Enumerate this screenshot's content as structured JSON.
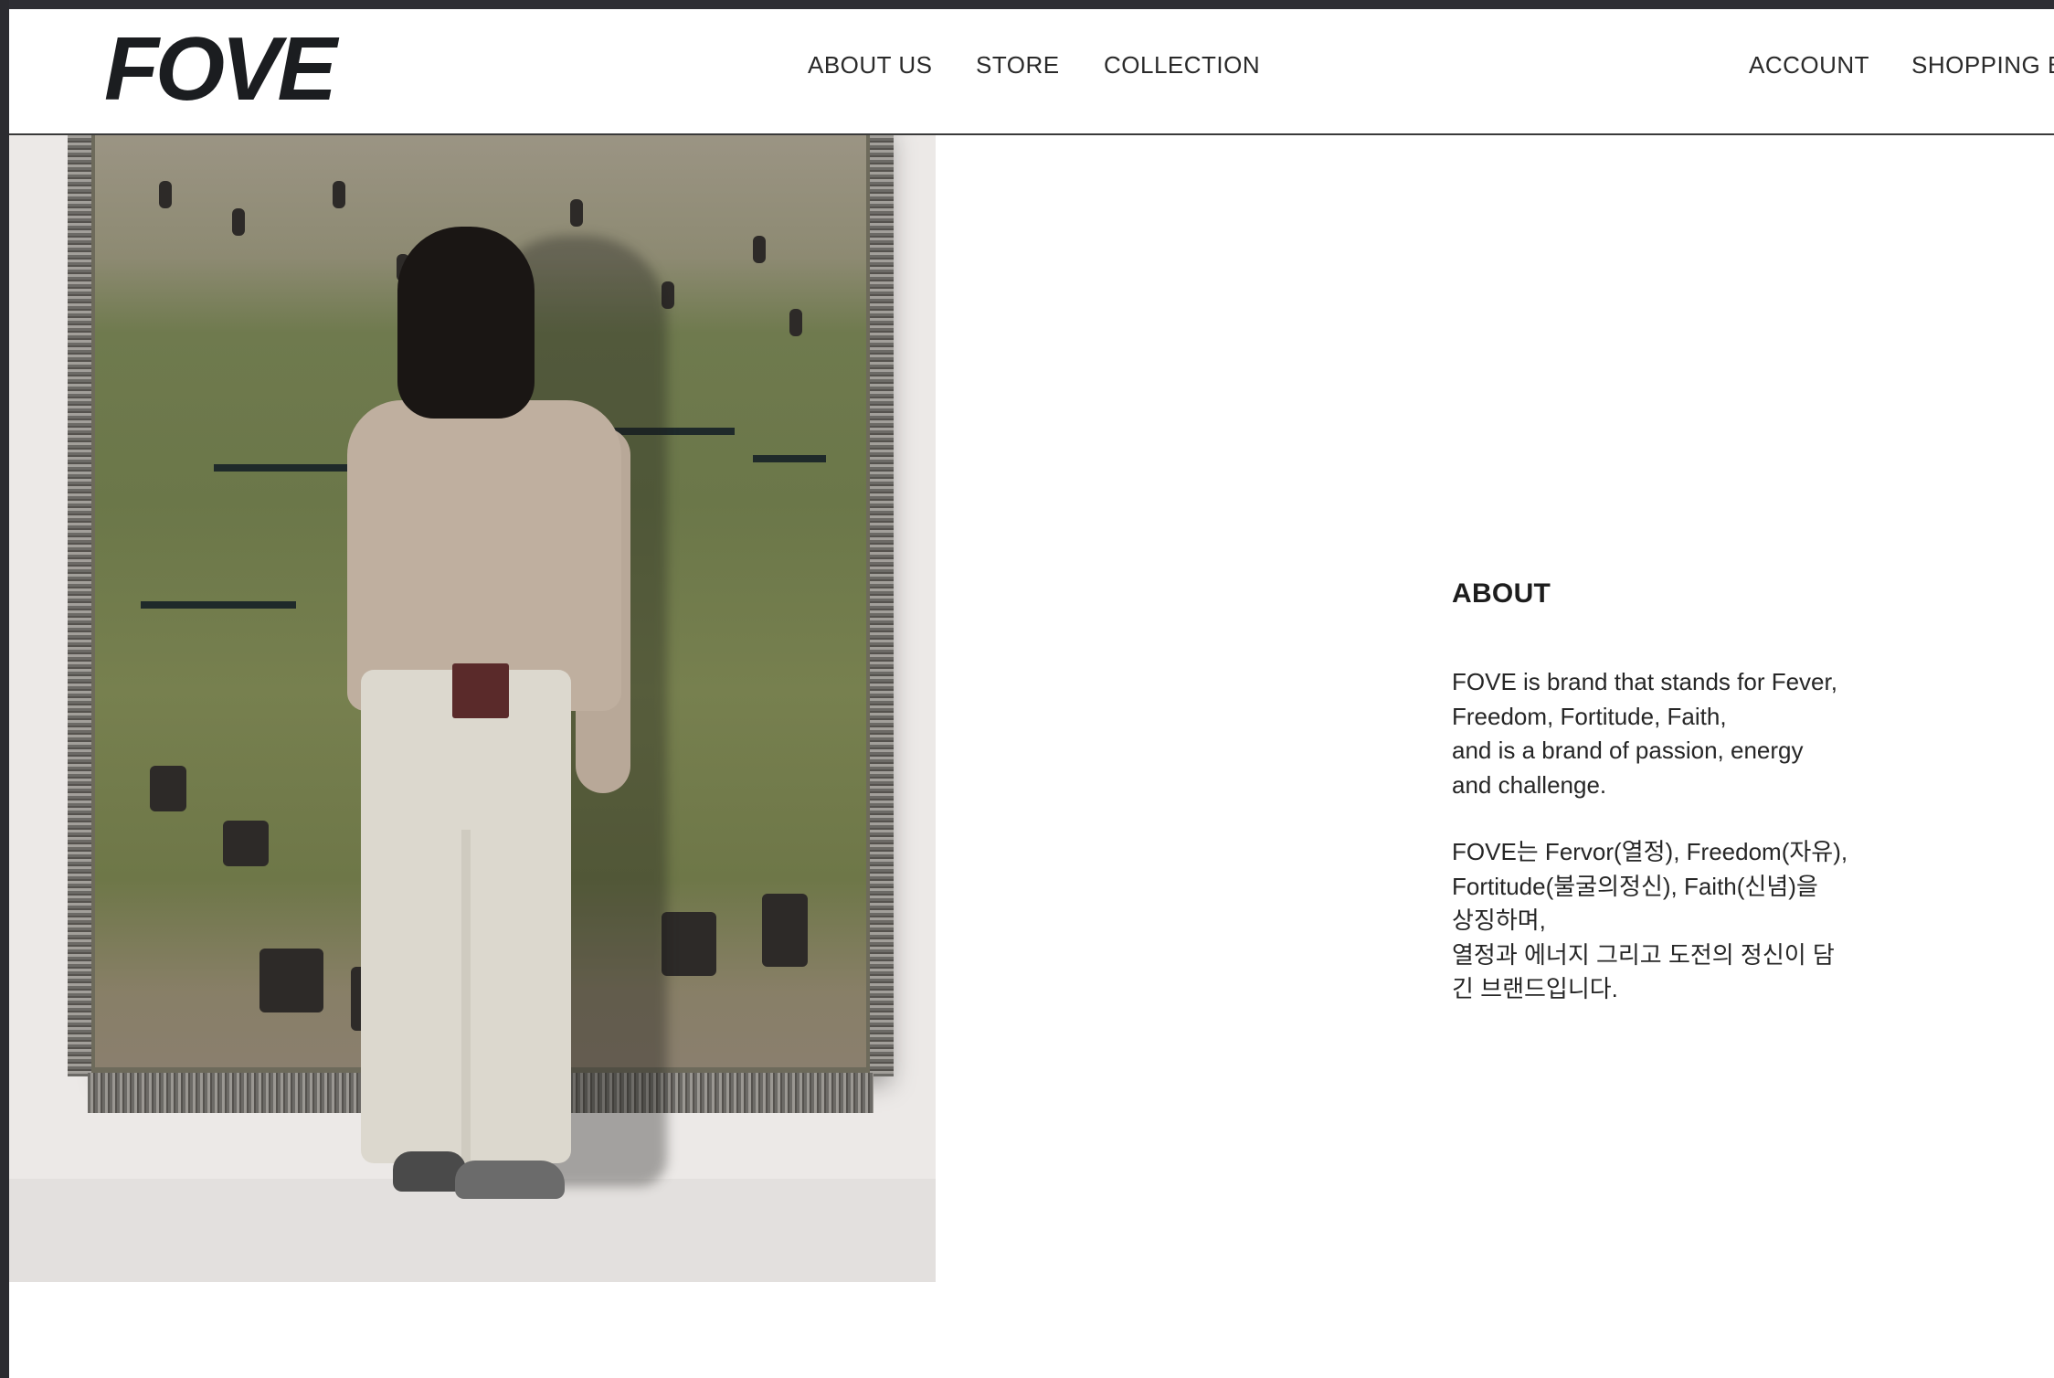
{
  "header": {
    "logo": "FOVE",
    "nav": {
      "about_us": "ABOUT US",
      "store": "STORE",
      "collection": "COLLECTION",
      "account": "ACCOUNT",
      "shopping_bag": "SHOPPING BA"
    }
  },
  "hero_image": {
    "description_icon": "photo-model-in-front-of-tapestry"
  },
  "about": {
    "title": "ABOUT",
    "paragraph_en": "FOVE is brand that stands for Fever,\nFreedom, Fortitude, Faith,\nand is a brand of passion, energy\nand challenge.",
    "paragraph_ko": "FOVE는 Fervor(열정), Freedom(자유),\nFortitude(불굴의정신), Faith(신념)을\n상징하며,\n열정과 에너지 그리고 도전의 정신이 담\n긴 브랜드입니다."
  }
}
